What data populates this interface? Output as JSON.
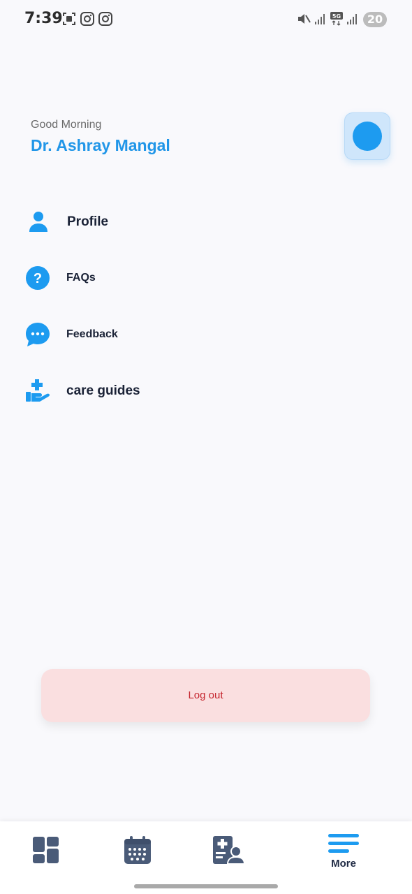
{
  "status_bar": {
    "time": "7:39",
    "left_icons": [
      "screenshot-icon",
      "instagram-icon",
      "instagram-icon"
    ],
    "right_icons": [
      "mute-icon",
      "signal-icon",
      "5g-icon",
      "signal-icon"
    ],
    "battery": "20"
  },
  "header": {
    "greeting": "Good Morning",
    "name": "Dr. Ashray Mangal"
  },
  "menu": {
    "items": [
      {
        "label": "Profile",
        "icon": "person-icon"
      },
      {
        "label": "FAQs",
        "icon": "question-icon"
      },
      {
        "label": "Feedback",
        "icon": "chat-bubble-icon"
      },
      {
        "label": "care guides",
        "icon": "care-hand-icon"
      }
    ]
  },
  "logout": {
    "label": "Log out"
  },
  "bottom_nav": {
    "items": [
      {
        "icon": "dashboard-icon",
        "label": ""
      },
      {
        "icon": "calendar-icon",
        "label": ""
      },
      {
        "icon": "medical-record-icon",
        "label": ""
      },
      {
        "icon": "menu-icon",
        "label": "More"
      }
    ]
  },
  "colors": {
    "accent": "#2196e8",
    "logout_bg": "#fadfe0",
    "logout_text": "#c5262f",
    "nav_icon": "#4a5b78"
  }
}
